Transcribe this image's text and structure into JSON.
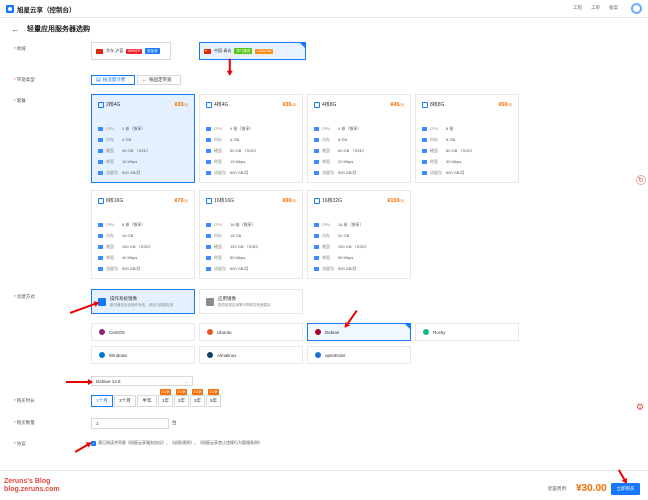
{
  "topbar": {
    "logo_text": "旭星云享（控制台）",
    "links": [
      "工程",
      "工单",
      "备案"
    ]
  },
  "page": {
    "title": "轻量应用服务器选购"
  },
  "labels": {
    "region": "地域",
    "billing": "带宽类型",
    "plan": "套餐",
    "create_method": "创建方式",
    "image": "",
    "duration": "购买时长",
    "quantity": "购买数量",
    "agreement": "协议"
  },
  "regions": [
    {
      "name": "华东-沪蓝",
      "tag": "BHKEP",
      "tag2": "新加坡"
    },
    {
      "name": "中国-青岛",
      "tag": "热门推荐",
      "tag2": "CN2/GIA"
    }
  ],
  "billing": {
    "options": [
      "按流量计费",
      "按固定带宽"
    ]
  },
  "spec_labels": {
    "cpu": "CPU",
    "mem": "内存",
    "disk": "硬盘",
    "bw": "带宽",
    "traffic": "流量包"
  },
  "plans": [
    {
      "name": "2核4G",
      "price": "¥30",
      "unit": "/月",
      "cpu": "2 核（独享）",
      "mem": "4 GB",
      "disk": "40 GB （SSD）",
      "bw": "10 Mbps",
      "traffic": "500 GB/月"
    },
    {
      "name": "4核4G",
      "price": "¥35",
      "unit": "/月",
      "cpu": "4 核（独享）",
      "mem": "4 GB",
      "disk": "50 GB （SSD）",
      "bw": "15 Mbps",
      "traffic": "500 GB/月"
    },
    {
      "name": "4核8G",
      "price": "¥45",
      "unit": "/月",
      "cpu": "4 核（独享）",
      "mem": "8 GB",
      "disk": "60 GB （SSD）",
      "bw": "20 Mbps",
      "traffic": "500 GB/月"
    },
    {
      "name": "8核8G",
      "price": "¥50",
      "unit": "/月",
      "cpu": "8 核",
      "mem": "8 GB",
      "disk": "80 GB （SSD）",
      "bw": "30 Mbps",
      "traffic": "500 GB/月"
    },
    {
      "name": "8核16G",
      "price": "¥70",
      "unit": "/月",
      "cpu": "8 核（独享）",
      "mem": "16 GB",
      "disk": "100 GB （SSD）",
      "bw": "40 Mbps",
      "traffic": "500 GB/月"
    },
    {
      "name": "16核16G",
      "price": "¥90",
      "unit": "/月",
      "cpu": "16 核（独享）",
      "mem": "16 GB",
      "disk": "120 GB （SSD）",
      "bw": "50 Mbps",
      "traffic": "500 GB/月"
    },
    {
      "name": "16核32G",
      "price": "¥150",
      "unit": "/月",
      "cpu": "16 核（独享）",
      "mem": "32 GB",
      "disk": "150 GB （SSD）",
      "bw": "50 Mbps",
      "traffic": "500 GB/月"
    }
  ],
  "create_methods": [
    {
      "title": "操作系统镜像",
      "desc": "服务器仅包含操作系统，请自行搭建应用"
    },
    {
      "title": "应用镜像",
      "desc": "提供各类应用等可帮助您快速建站"
    }
  ],
  "os_list": [
    "CentOS",
    "Ubuntu",
    "Debian",
    "Rocky",
    "Windows",
    "Almalinux",
    "openEuler"
  ],
  "os_select": {
    "value": "Debian-12.6"
  },
  "durations": [
    {
      "label": "1个月"
    },
    {
      "label": "3个月"
    },
    {
      "label": "半年"
    },
    {
      "label": "1年",
      "badge": "8.5折"
    },
    {
      "label": "2年",
      "badge": "8.5折"
    },
    {
      "label": "3年",
      "badge": "8.5折"
    },
    {
      "label": "5年",
      "badge": "8.5折"
    }
  ],
  "quantity": {
    "value": "1",
    "unit": "台"
  },
  "agreement": {
    "text": "我已阅读并同意《旭星云享服务协议》、《退款规则》、《旭星云享禁止违规行为管理条例》"
  },
  "footer": {
    "blog_line1": "Zeruns's Blog",
    "blog_line2": "blog.zeruns.com",
    "total_label": "配置费用:",
    "total_price": "¥30.00",
    "buy_label": "立即购买"
  },
  "colors": {
    "accent": "#1677ff",
    "price": "#f56c00",
    "danger": "#f5222d"
  }
}
